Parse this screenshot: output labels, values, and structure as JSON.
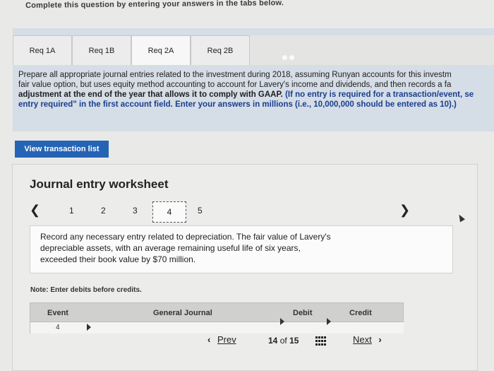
{
  "header": {
    "instruction_line": "Complete this question by entering your answers in the tabs below."
  },
  "tabs": [
    {
      "label": "Req 1A"
    },
    {
      "label": "Req 1B"
    },
    {
      "label": "Req 2A",
      "active": true
    },
    {
      "label": "Req 2B"
    }
  ],
  "instructions": {
    "line1": "Prepare all appropriate journal entries related to the investment during 2018, assuming Runyan accounts for this investm",
    "line2": "fair value option, but uses equity method accounting to account for Lavery's income and dividends, and then records a fa",
    "line3_plain": "adjustment at the end of the year that allows it to comply with GAAP. ",
    "line3_bold": "(If no entry is required for a transaction/event, se",
    "line4": "entry required\" in the first account field. Enter your answers in millions (i.e., 10,000,000 should be entered as 10).)"
  },
  "view_transaction_button": "View transaction list",
  "worksheet": {
    "title": "Journal entry worksheet",
    "pages": [
      "1",
      "2",
      "3",
      "4",
      "5"
    ],
    "current_page": "4",
    "prev_icon": "chevron-left-icon",
    "next_icon": "chevron-right-icon",
    "prompt_line1": "Record any necessary entry related to depreciation. The fair value of Lavery's",
    "prompt_line2": "depreciable assets, with an average remaining useful life of six years,",
    "prompt_line3": "exceeded their book value by $70 million.",
    "note": "Note: Enter debits before credits.",
    "columns": {
      "event": "Event",
      "general_journal": "General Journal",
      "debit": "Debit",
      "credit": "Credit"
    },
    "first_row_event": "4"
  },
  "footer": {
    "prev_label": "Prev",
    "page_current": "14",
    "page_of": "of",
    "page_total": "15",
    "next_label": "Next",
    "grid_icon": "grid-icon"
  },
  "colors": {
    "primary_button": "#2563b5",
    "instruction_blue": "#1a3f8f",
    "panel_bg": "#d5dde6"
  }
}
